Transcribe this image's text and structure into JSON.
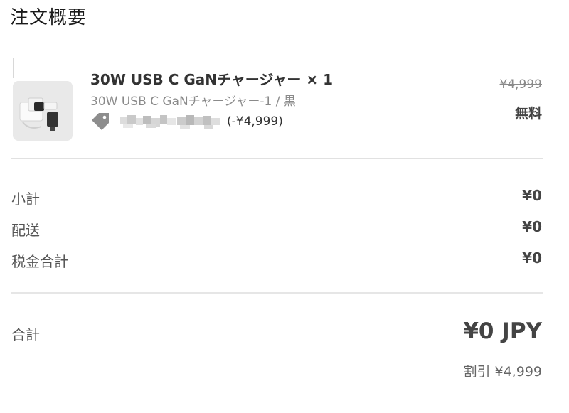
{
  "summary": {
    "title": "注文概要"
  },
  "line_item": {
    "name": "30W USB C GaNチャージャー × 1",
    "variant": "30W USB C GaNチャージャー-1 / 黒",
    "tag_icon": "tag-icon",
    "discount_amount": "(-¥4,999)",
    "original_price": "¥4,999",
    "final_price": "無料"
  },
  "totals": {
    "subtotal_label": "小計",
    "subtotal_value": "¥0",
    "shipping_label": "配送",
    "shipping_value": "¥0",
    "tax_label": "税金合計",
    "tax_value": "¥0",
    "total_label": "合計",
    "total_value": "¥0 JPY",
    "savings_text": "割引 ¥4,999"
  },
  "colors": {
    "text_dark": "#333333",
    "text_muted": "#8a8a8a",
    "divider": "#e1e1e1",
    "thumbnail_bg": "#e9e9e9"
  }
}
